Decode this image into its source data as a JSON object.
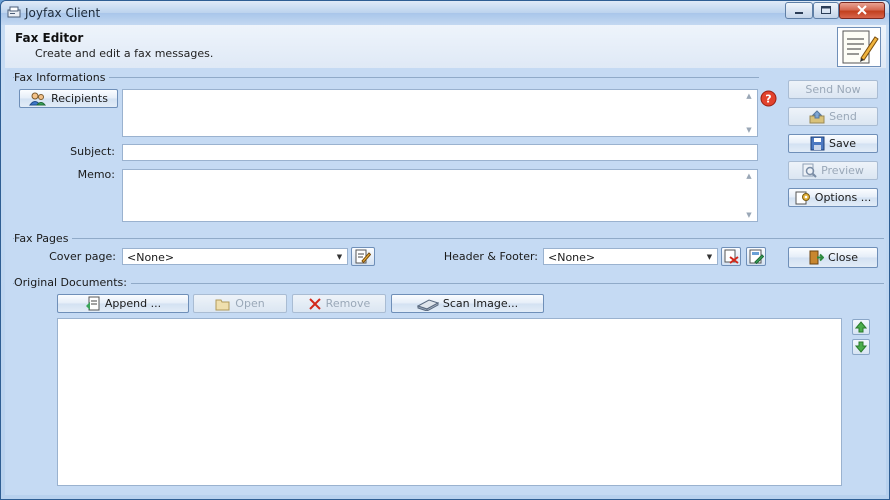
{
  "window": {
    "title": "Joyfax Client"
  },
  "header": {
    "title": "Fax Editor",
    "subtitle": "Create and edit a fax messages."
  },
  "fax_info": {
    "group_label": "Fax Informations",
    "recipients_button": "Recipients",
    "recipients_value": "",
    "subject_label": "Subject:",
    "subject_value": "",
    "memo_label": "Memo:",
    "memo_value": ""
  },
  "side_buttons": {
    "send_now": "Send Now",
    "send": "Send",
    "save": "Save",
    "preview": "Preview",
    "options": "Options ...",
    "close": "Close"
  },
  "fax_pages": {
    "group_label": "Fax Pages",
    "cover_page_label": "Cover page:",
    "cover_page_value": "<None>",
    "header_footer_label": "Header & Footer:",
    "header_footer_value": "<None>"
  },
  "original_documents": {
    "group_label": "Original Documents:",
    "append_button": "Append ...",
    "open_button": "Open",
    "remove_button": "Remove",
    "scan_button": "Scan Image...",
    "items": []
  },
  "colors": {
    "window_bg": "#c5daf3",
    "header_bg": "#e6eef8",
    "close_button": "#c2401f"
  },
  "icons": {
    "app": "fax-machine-icon",
    "header": "document-pencil-icon",
    "recipients": "people-icon",
    "help": "red-question-icon"
  }
}
